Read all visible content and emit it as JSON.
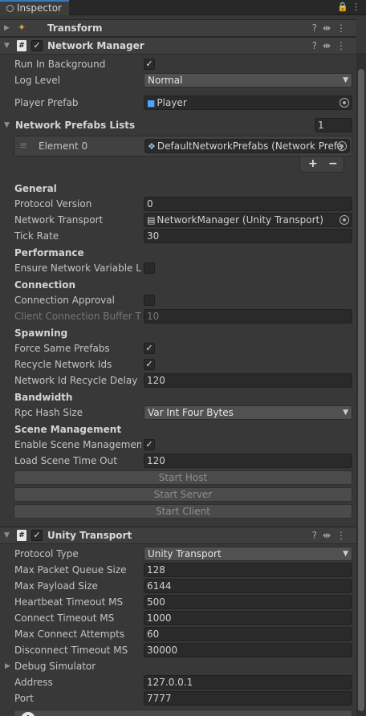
{
  "window": {
    "tab_title": "Inspector"
  },
  "transform": {
    "title": "Transform"
  },
  "network_manager": {
    "title": "Network Manager",
    "run_in_background": {
      "label": "Run In Background",
      "checked": true
    },
    "log_level": {
      "label": "Log Level",
      "value": "Normal"
    },
    "player_prefab": {
      "label": "Player Prefab",
      "value": "Player"
    },
    "prefab_lists": {
      "label": "Network Prefabs Lists",
      "count": "1",
      "element_label": "Element 0",
      "element_value": "DefaultNetworkPrefabs (Network Prefa"
    },
    "general": {
      "header": "General",
      "protocol_version": {
        "label": "Protocol Version",
        "value": "0"
      },
      "network_transport": {
        "label": "Network Transport",
        "value": "NetworkManager (Unity Transport)"
      },
      "tick_rate": {
        "label": "Tick Rate",
        "value": "30"
      }
    },
    "performance": {
      "header": "Performance",
      "ensure_nv": {
        "label": "Ensure Network Variable Ler",
        "checked": false
      }
    },
    "connection": {
      "header": "Connection",
      "approval": {
        "label": "Connection Approval",
        "checked": false
      },
      "buffer": {
        "label": "Client Connection Buffer Tim",
        "value": "10"
      }
    },
    "spawning": {
      "header": "Spawning",
      "force_same": {
        "label": "Force Same Prefabs",
        "checked": true
      },
      "recycle_ids": {
        "label": "Recycle Network Ids",
        "checked": true
      },
      "recycle_delay": {
        "label": "Network Id Recycle Delay",
        "value": "120"
      }
    },
    "bandwidth": {
      "header": "Bandwidth",
      "rpc_hash": {
        "label": "Rpc Hash Size",
        "value": "Var Int Four Bytes"
      }
    },
    "scene": {
      "header": "Scene Management",
      "enable": {
        "label": "Enable Scene Management",
        "checked": true
      },
      "timeout": {
        "label": "Load Scene Time Out",
        "value": "120"
      }
    },
    "buttons": {
      "start_host": "Start Host",
      "start_server": "Start Server",
      "start_client": "Start Client"
    }
  },
  "unity_transport": {
    "title": "Unity Transport",
    "protocol_type": {
      "label": "Protocol Type",
      "value": "Unity Transport"
    },
    "max_packet_queue": {
      "label": "Max Packet Queue Size",
      "value": "128"
    },
    "max_payload": {
      "label": "Max Payload Size",
      "value": "6144"
    },
    "heartbeat": {
      "label": "Heartbeat Timeout MS",
      "value": "500"
    },
    "connect_timeout": {
      "label": "Connect Timeout MS",
      "value": "1000"
    },
    "max_connect": {
      "label": "Max Connect Attempts",
      "value": "60"
    },
    "disconnect_timeout": {
      "label": "Disconnect Timeout MS",
      "value": "30000"
    },
    "debug_simulator": {
      "label": "Debug Simulator"
    },
    "address": {
      "label": "Address",
      "value": "127.0.0.1"
    },
    "port": {
      "label": "Port",
      "value": "7777"
    }
  }
}
